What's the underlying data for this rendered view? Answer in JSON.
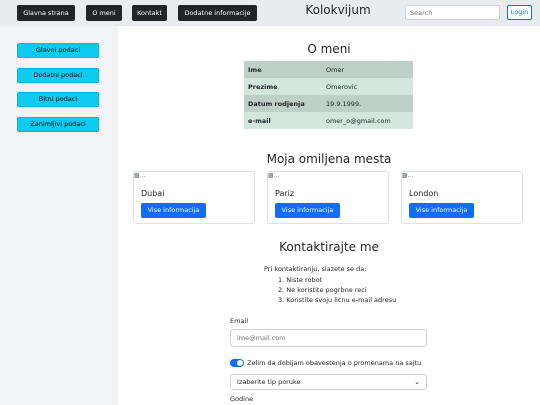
{
  "nav": {
    "items": [
      "Glavna strana",
      "O meni",
      "Kontakt",
      "Dodatne informacije"
    ],
    "brand": "Kolokvijum",
    "search_placeholder": "Search",
    "login_label": "Login"
  },
  "sidebar": {
    "items": [
      "Glavni podaci",
      "Dodatni podaci",
      "Bitni podaci",
      "Zanimljivi podaci"
    ]
  },
  "about": {
    "title": "O meni",
    "rows": [
      {
        "key": "Ime",
        "value": "Omer"
      },
      {
        "key": "Prezime",
        "value": "Omerovic"
      },
      {
        "key": "Datum rodjenja",
        "value": "19.9.1999."
      },
      {
        "key": "e-mail",
        "value": "omer_o@gmail.com"
      }
    ]
  },
  "places": {
    "title": "Moja omiljena mesta",
    "image_alt": "...",
    "button_label": "Vise informacija",
    "cities": [
      "Dubai",
      "Pariz",
      "London"
    ]
  },
  "contact": {
    "title": "Kontaktirajte me",
    "intro": "Pri kontaktiranju, slazete se da:",
    "rules": [
      "Niste robot",
      "Ne koristite pogrbne reci",
      "Koristite svoju licnu e-mail adresu"
    ],
    "email_label": "Email",
    "email_placeholder": "ime@mail.com",
    "notify_label": "Zelim da dobijam obavestenja o promenama na sajtu",
    "notify_on": true,
    "select_value": "Izaberite tip poruke",
    "years_label": "Godine"
  },
  "colors": {
    "nav_button": "#212529",
    "sidebar_button": "#0dcaf0",
    "primary": "#0d6efd",
    "table_dark": "#bcd0c7",
    "table_light": "#d1e7dd"
  }
}
